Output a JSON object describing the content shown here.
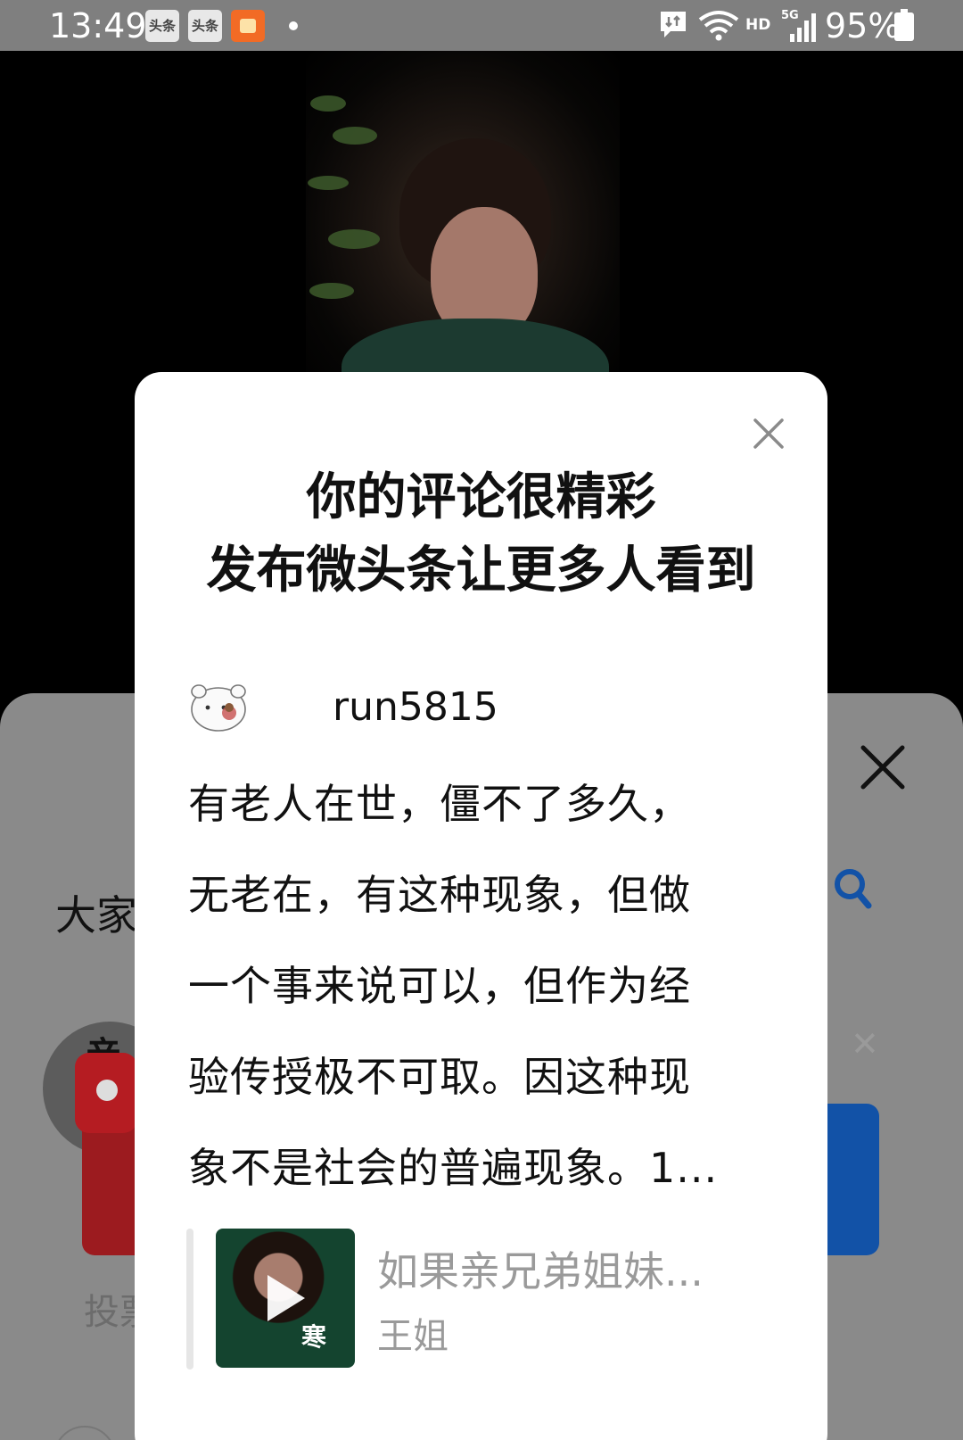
{
  "status_bar": {
    "time": "13:49",
    "app_icon_1": "头条",
    "app_icon_2": "头条",
    "network": "HD",
    "signal": "5G",
    "battery": "95%"
  },
  "background_sheet": {
    "title_partial": "大家",
    "cover_text_partial": "亲",
    "vote_partial": "投票"
  },
  "popup": {
    "title_line1": "你的评论很精彩",
    "title_line2": "发布微头条让更多人看到",
    "username": "run5815",
    "comment_lines": [
      "有老人在世，僵不了多久，",
      "无老在，有这种现象，但做",
      "一个事来说可以，但作为经",
      "验传授极不可取。因这种现",
      "象不是社会的普遍现象。1..."
    ],
    "quote": {
      "title": "如果亲兄弟姐妹...",
      "author": "王姐",
      "thumb_caption": "寒"
    }
  },
  "colors": {
    "accent_blue": "#1252a7",
    "red_packet": "#b51c22",
    "muted_text": "#9a9a9a"
  },
  "icons": [
    "close-icon",
    "search-icon",
    "play-icon",
    "wifi-icon",
    "signal-icon",
    "battery-icon",
    "message-icon",
    "red-packet-icon"
  ]
}
